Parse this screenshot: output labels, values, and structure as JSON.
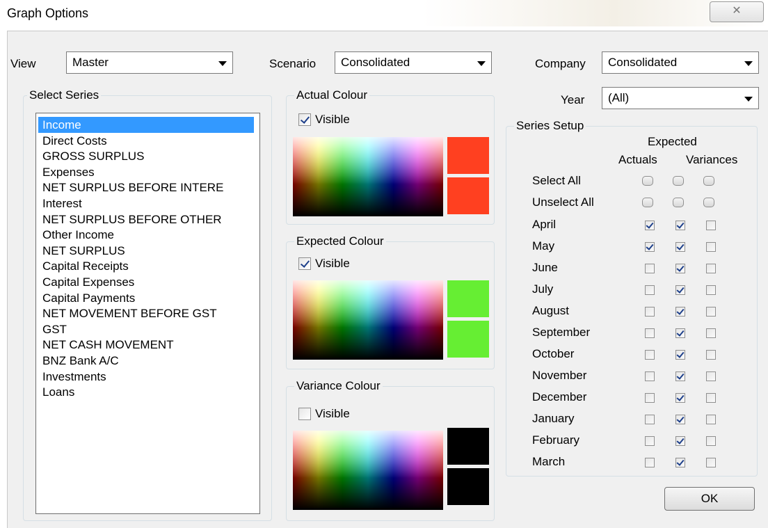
{
  "window": {
    "title": "Graph Options",
    "close_glyph": "✕"
  },
  "view": {
    "label": "View",
    "value": "Master"
  },
  "scenario": {
    "label": "Scenario",
    "value": "Consolidated"
  },
  "company": {
    "label": "Company",
    "value": "Consolidated"
  },
  "year": {
    "label": "Year",
    "value": "(All)"
  },
  "select_series": {
    "title": "Select Series",
    "selected_index": 0,
    "items": [
      "Income",
      "Direct Costs",
      "GROSS SURPLUS",
      "Expenses",
      "NET SURPLUS BEFORE INTERE",
      "Interest",
      "NET SURPLUS BEFORE OTHER",
      "Other Income",
      "NET SURPLUS",
      "Capital Receipts",
      "Capital Expenses",
      "Capital Payments",
      "NET MOVEMENT BEFORE GST",
      "GST",
      "NET CASH MOVEMENT",
      "BNZ Bank A/C",
      "Investments",
      "Loans"
    ]
  },
  "colours": {
    "actual": {
      "title": "Actual Colour",
      "visible_label": "Visible",
      "visible": true,
      "color": "#ff4020"
    },
    "expected": {
      "title": "Expected Colour",
      "visible_label": "Visible",
      "visible": true,
      "color": "#66ee33"
    },
    "variance": {
      "title": "Variance Colour",
      "visible_label": "Visible",
      "visible": false,
      "color": "#000000"
    }
  },
  "series_setup": {
    "title": "Series Setup",
    "header_top": "Expected",
    "columns": [
      "Actuals",
      "Variances"
    ],
    "select_all": "Select All",
    "unselect_all": "Unselect All",
    "months": [
      {
        "name": "April",
        "actuals": true,
        "expected": true,
        "variances": false
      },
      {
        "name": "May",
        "actuals": true,
        "expected": true,
        "variances": false
      },
      {
        "name": "June",
        "actuals": false,
        "expected": true,
        "variances": false
      },
      {
        "name": "July",
        "actuals": false,
        "expected": true,
        "variances": false
      },
      {
        "name": "August",
        "actuals": false,
        "expected": true,
        "variances": false
      },
      {
        "name": "September",
        "actuals": false,
        "expected": true,
        "variances": false
      },
      {
        "name": "October",
        "actuals": false,
        "expected": true,
        "variances": false
      },
      {
        "name": "November",
        "actuals": false,
        "expected": true,
        "variances": false
      },
      {
        "name": "December",
        "actuals": false,
        "expected": true,
        "variances": false
      },
      {
        "name": "January",
        "actuals": false,
        "expected": true,
        "variances": false
      },
      {
        "name": "February",
        "actuals": false,
        "expected": true,
        "variances": false
      },
      {
        "name": "March",
        "actuals": false,
        "expected": true,
        "variances": false
      }
    ]
  },
  "ok_label": "OK"
}
